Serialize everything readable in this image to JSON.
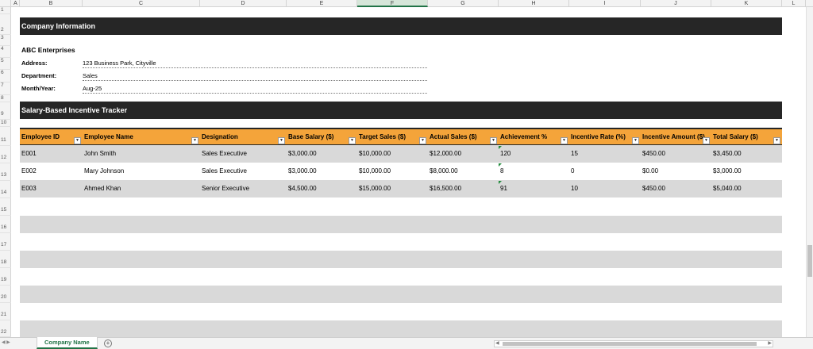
{
  "columns": [
    "A",
    "B",
    "C",
    "D",
    "E",
    "F",
    "G",
    "H",
    "I",
    "J",
    "K",
    "L"
  ],
  "selected_column": "F",
  "rows": [
    "1",
    "2",
    "3",
    "4",
    "5",
    "6",
    "7",
    "8",
    "9",
    "10",
    "11",
    "12",
    "13",
    "14",
    "15",
    "16",
    "17",
    "18",
    "19",
    "20",
    "21",
    "22"
  ],
  "company_banner": "Company Information",
  "company_name": "ABC Enterprises",
  "info": [
    {
      "label": "Address:",
      "value": "123 Business Park, Cityville"
    },
    {
      "label": "Department:",
      "value": "Sales"
    },
    {
      "label": "Month/Year:",
      "value": "Aug-25"
    }
  ],
  "tracker_banner": "Salary-Based Incentive Tracker",
  "table": {
    "headers": [
      "Employee ID",
      "Employee Name",
      "Designation",
      "Base Salary ($)",
      "Target Sales ($)",
      "Actual Sales ($)",
      "Achievement %",
      "Incentive Rate (%)",
      "Incentive Amount ($)",
      "Total Salary ($)"
    ],
    "rows": [
      [
        "E001",
        "John Smith",
        "Sales Executive",
        "$3,000.00",
        "$10,000.00",
        "$12,000.00",
        "120",
        "15",
        "$450.00",
        "$3,450.00"
      ],
      [
        "E002",
        "Mary Johnson",
        "Sales Executive",
        "$3,000.00",
        "$10,000.00",
        "$8,000.00",
        "8",
        "0",
        "$0.00",
        "$3,000.00"
      ],
      [
        "E003",
        "Ahmed Khan",
        "Senior Executive",
        "$4,500.00",
        "$15,000.00",
        "$16,500.00",
        "91",
        "10",
        "$450.00",
        "$5,040.00"
      ]
    ]
  },
  "sheet_tab": "Company Name",
  "add_sheet_icon": "plus-circle-icon",
  "colors": {
    "banner": "#262626",
    "header": "#f4a43a",
    "band": "#d9d9d9",
    "accent": "#217346"
  }
}
